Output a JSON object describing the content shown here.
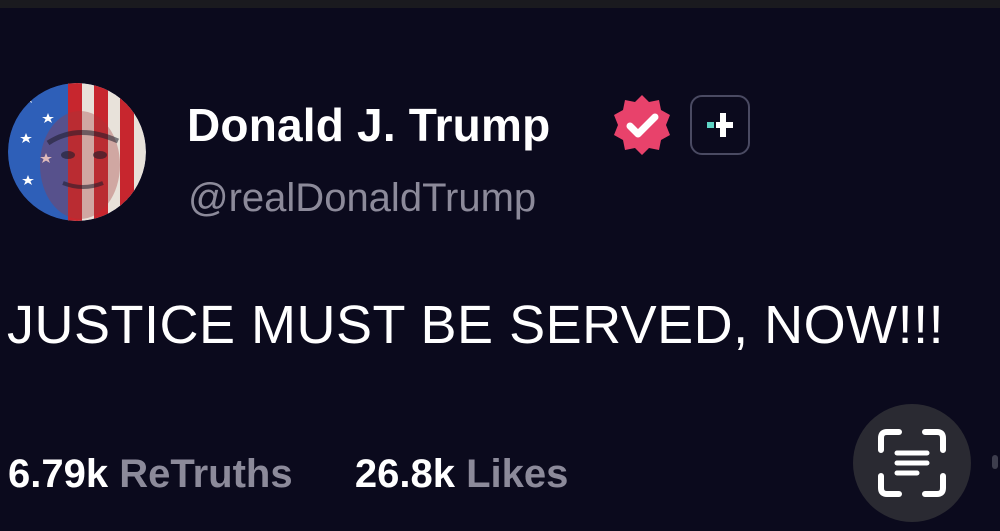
{
  "post": {
    "author": {
      "display_name": "Donald J. Trump",
      "handle": "@realDonaldTrump",
      "verified": true,
      "badge_color": "#e8426b"
    },
    "text": "JUSTICE MUST BE SERVED, NOW!!!",
    "stats": {
      "retruths_count": "6.79k",
      "retruths_label": "ReTruths",
      "likes_count": "26.8k",
      "likes_label": "Likes"
    }
  },
  "icons": {
    "avatar": "american-flag-portrait",
    "verified": "verified-badge-icon",
    "follow": "plus-icon",
    "scan": "text-scan-icon"
  },
  "colors": {
    "background": "#0b0a1d",
    "primary_text": "#ffffff",
    "secondary_text": "#8c8a9a",
    "accent": "#5ed3c4"
  }
}
